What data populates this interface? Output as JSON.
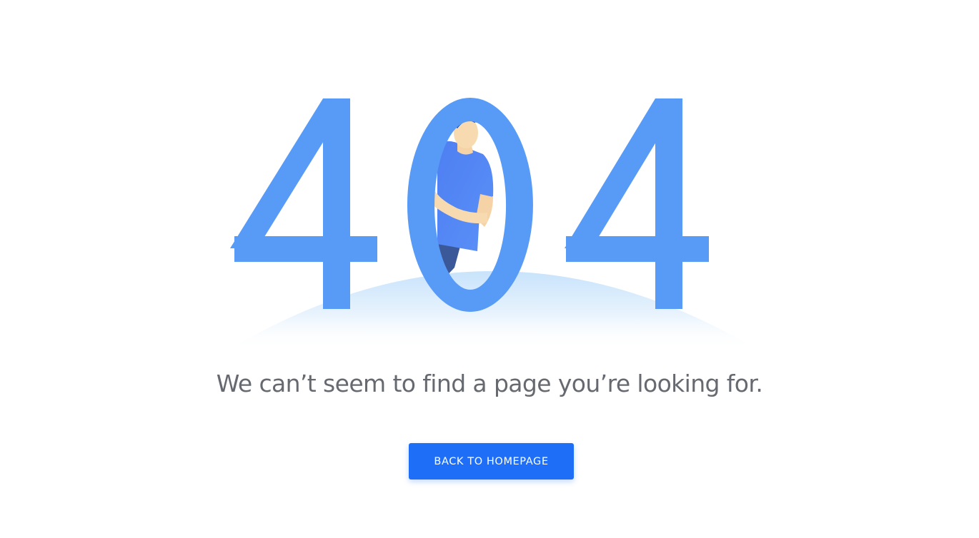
{
  "error": {
    "code": "404",
    "message": "We can’t seem to find a page you’re looking for."
  },
  "actions": {
    "back_label": "BACK TO HOMEPAGE"
  },
  "colors": {
    "digits": "#589bf7",
    "button": "#1f6ef7",
    "message_text": "#666a70",
    "ground": "#cfe6fb"
  },
  "illustration": "person-peeking-through-zero"
}
